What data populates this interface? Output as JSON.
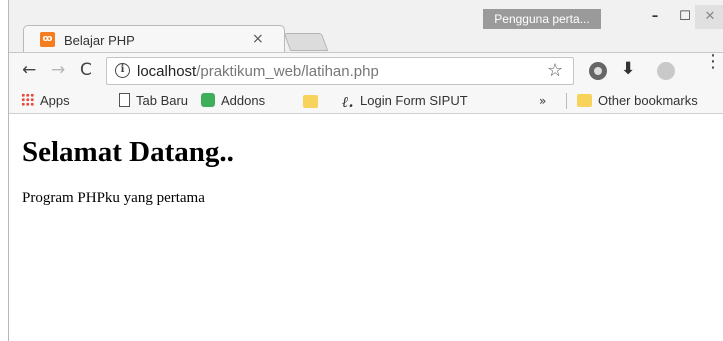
{
  "tab": {
    "favicon": "xampp-icon",
    "title": "Belajar PHP",
    "close": "×"
  },
  "profile": {
    "label": "Pengguna perta..."
  },
  "window_controls": {
    "minimize": "–",
    "maximize": "☐",
    "close": "✕"
  },
  "nav": {
    "back": "←",
    "forward": "→",
    "reload": "C"
  },
  "address": {
    "host": "localhost",
    "path": "/praktikum_web/latihan.php",
    "info": "i",
    "star": "☆"
  },
  "extensions": {
    "download": "⬇",
    "menu": "⋮"
  },
  "bookmarks": {
    "items": [
      {
        "label": "Apps",
        "icon": "apps-grid-icon"
      },
      {
        "label": "Tab Baru",
        "icon": "page-icon"
      },
      {
        "label": "Addons",
        "icon": "puzzle-icon"
      },
      {
        "label": "",
        "icon": "folder-icon"
      },
      {
        "label": "Login Form SIPUT",
        "icon": "script-icon"
      }
    ],
    "overflow": "»",
    "other": "Other bookmarks"
  },
  "page": {
    "heading": "Selamat Datang..",
    "paragraph": "Program PHPku yang pertama"
  }
}
